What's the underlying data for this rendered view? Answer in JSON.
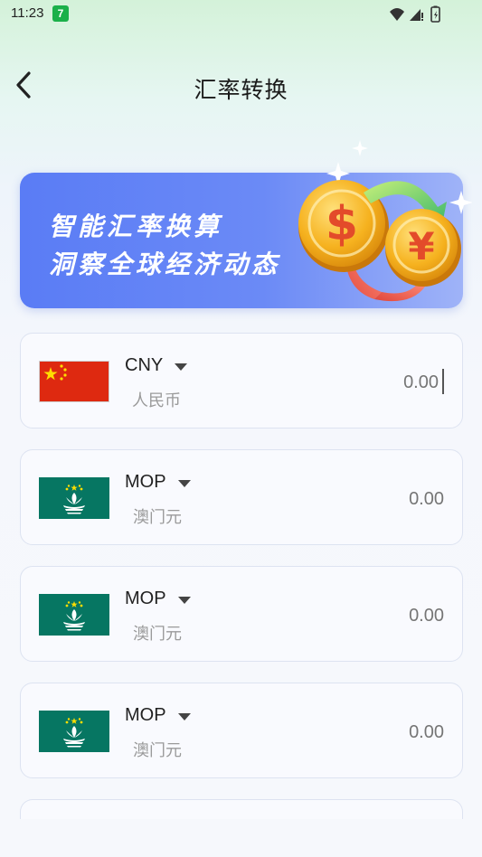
{
  "status_bar": {
    "time": "11:23",
    "notification_badge": "7",
    "icons": [
      "wifi-icon",
      "signal-icon",
      "battery-icon"
    ]
  },
  "header": {
    "title": "汇率转换",
    "back_icon": "chevron-left-icon"
  },
  "banner": {
    "line1": "智能汇率换算",
    "line2": "洞察全球经济动态",
    "gradient": [
      "#5a7cf5",
      "#9fb3f8"
    ],
    "art": "currency-exchange-coins-illustration"
  },
  "currencies": [
    {
      "code": "CNY",
      "name": "人民币",
      "amount_placeholder": "0.00",
      "flag": "china-flag",
      "focused": true
    },
    {
      "code": "MOP",
      "name": "澳门元",
      "amount_placeholder": "0.00",
      "flag": "macau-flag",
      "focused": false
    },
    {
      "code": "MOP",
      "name": "澳门元",
      "amount_placeholder": "0.00",
      "flag": "macau-flag",
      "focused": false
    },
    {
      "code": "MOP",
      "name": "澳门元",
      "amount_placeholder": "0.00",
      "flag": "macau-flag",
      "focused": false
    }
  ],
  "colors": {
    "china_red": "#de2910",
    "china_star": "#ffde00",
    "macau_green": "#067662",
    "accent_blue": "#5a7cf5"
  }
}
